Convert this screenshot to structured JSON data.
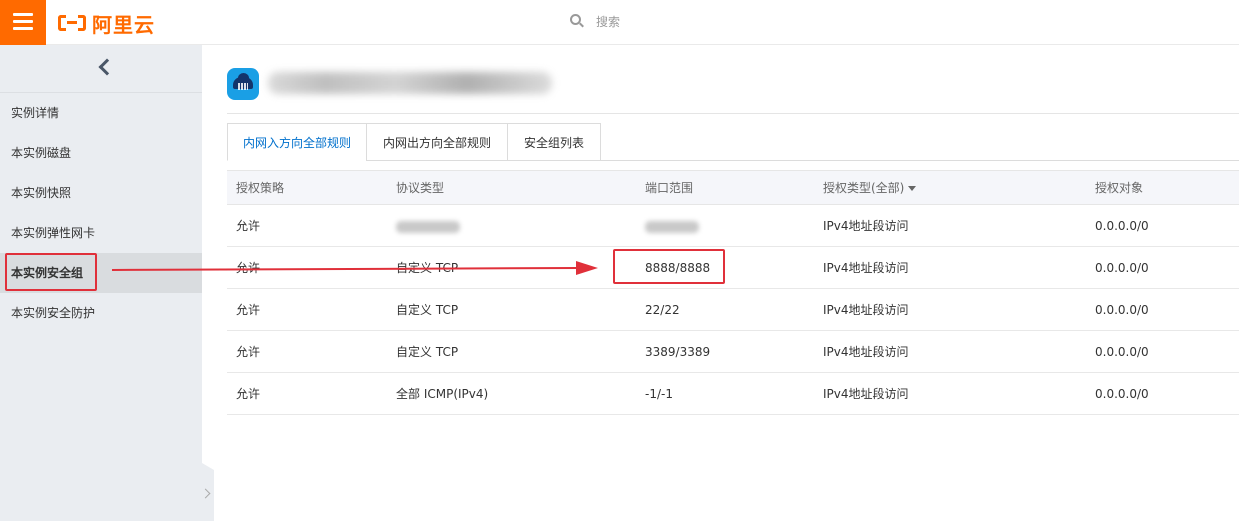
{
  "topbar": {
    "brand": "阿里云",
    "search_placeholder": "搜索"
  },
  "sidebar": {
    "items": [
      {
        "label": "实例详情"
      },
      {
        "label": "本实例磁盘"
      },
      {
        "label": "本实例快照"
      },
      {
        "label": "本实例弹性网卡"
      },
      {
        "label": "本实例安全组",
        "active": true
      },
      {
        "label": "本实例安全防护"
      }
    ]
  },
  "tabs": [
    {
      "label": "内网入方向全部规则",
      "active": true
    },
    {
      "label": "内网出方向全部规则"
    },
    {
      "label": "安全组列表"
    }
  ],
  "table": {
    "headers": [
      "授权策略",
      "协议类型",
      "端口范围",
      "授权类型(全部)",
      "授权对象"
    ],
    "rows": [
      {
        "policy": "允许",
        "protocol": "",
        "port": "",
        "auth_type": "IPv4地址段访问",
        "target": "0.0.0.0/0"
      },
      {
        "policy": "允许",
        "protocol": "自定义 TCP",
        "port": "8888/8888",
        "auth_type": "IPv4地址段访问",
        "target": "0.0.0.0/0"
      },
      {
        "policy": "允许",
        "protocol": "自定义 TCP",
        "port": "22/22",
        "auth_type": "IPv4地址段访问",
        "target": "0.0.0.0/0"
      },
      {
        "policy": "允许",
        "protocol": "自定义 TCP",
        "port": "3389/3389",
        "auth_type": "IPv4地址段访问",
        "target": "0.0.0.0/0"
      },
      {
        "policy": "允许",
        "protocol": "全部 ICMP(IPv4)",
        "port": "-1/-1",
        "auth_type": "IPv4地址段访问",
        "target": "0.0.0.0/0"
      }
    ]
  },
  "icons": {
    "menu": "menu-icon",
    "search": "search-icon",
    "back": "chevron-left-icon",
    "instance": "cloud-server-icon",
    "collapse": "chevron-right-icon"
  },
  "colors": {
    "brand": "#ff6a00",
    "active_tab": "#0070cc",
    "annotation": "#e0303a"
  }
}
